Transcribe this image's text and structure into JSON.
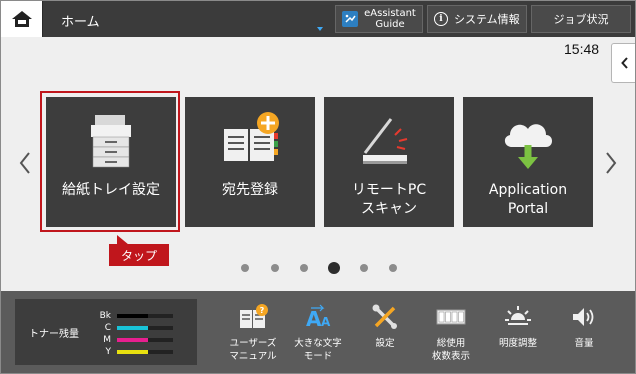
{
  "header": {
    "title": "ホーム",
    "eassistant": {
      "line1": "eAssistant",
      "line2": "Guide"
    },
    "system_info": "システム情報",
    "job_status": "ジョブ状況"
  },
  "clock": "15:48",
  "tiles": [
    {
      "line1": "給紙トレイ設定",
      "line2": ""
    },
    {
      "line1": "宛先登録",
      "line2": ""
    },
    {
      "line1": "リモートPC",
      "line2": "スキャン"
    },
    {
      "line1": "Application",
      "line2": "Portal"
    }
  ],
  "callout": {
    "text": "タップ"
  },
  "pager": {
    "pages": 6,
    "current": 4
  },
  "toner": {
    "title": "トナー残量",
    "rows": [
      {
        "code": "Bk",
        "color": "#000000",
        "level": 0.55
      },
      {
        "code": "C",
        "color": "#19c3d8",
        "level": 0.55
      },
      {
        "code": "M",
        "color": "#e81f8f",
        "level": 0.55
      },
      {
        "code": "Y",
        "color": "#e8e010",
        "level": 0.55
      }
    ]
  },
  "tools": [
    {
      "line1": "ユーザーズ",
      "line2": "マニュアル",
      "icon": "manual-icon"
    },
    {
      "line1": "大きな文字",
      "line2": "モード",
      "icon": "large-text-icon"
    },
    {
      "line1": "設定",
      "line2": "",
      "icon": "settings-tools-icon"
    },
    {
      "line1": "総使用",
      "line2": "枚数表示",
      "icon": "counter-icon"
    },
    {
      "line1": "明度調整",
      "line2": "",
      "icon": "brightness-icon"
    },
    {
      "line1": "音量",
      "line2": "",
      "icon": "volume-icon"
    }
  ],
  "colors": {
    "accent": "#c0161c",
    "tile_bg": "#3d3d3d",
    "topbar_bg": "#3b3b3b",
    "bottombar_bg": "#5b5b5b"
  }
}
